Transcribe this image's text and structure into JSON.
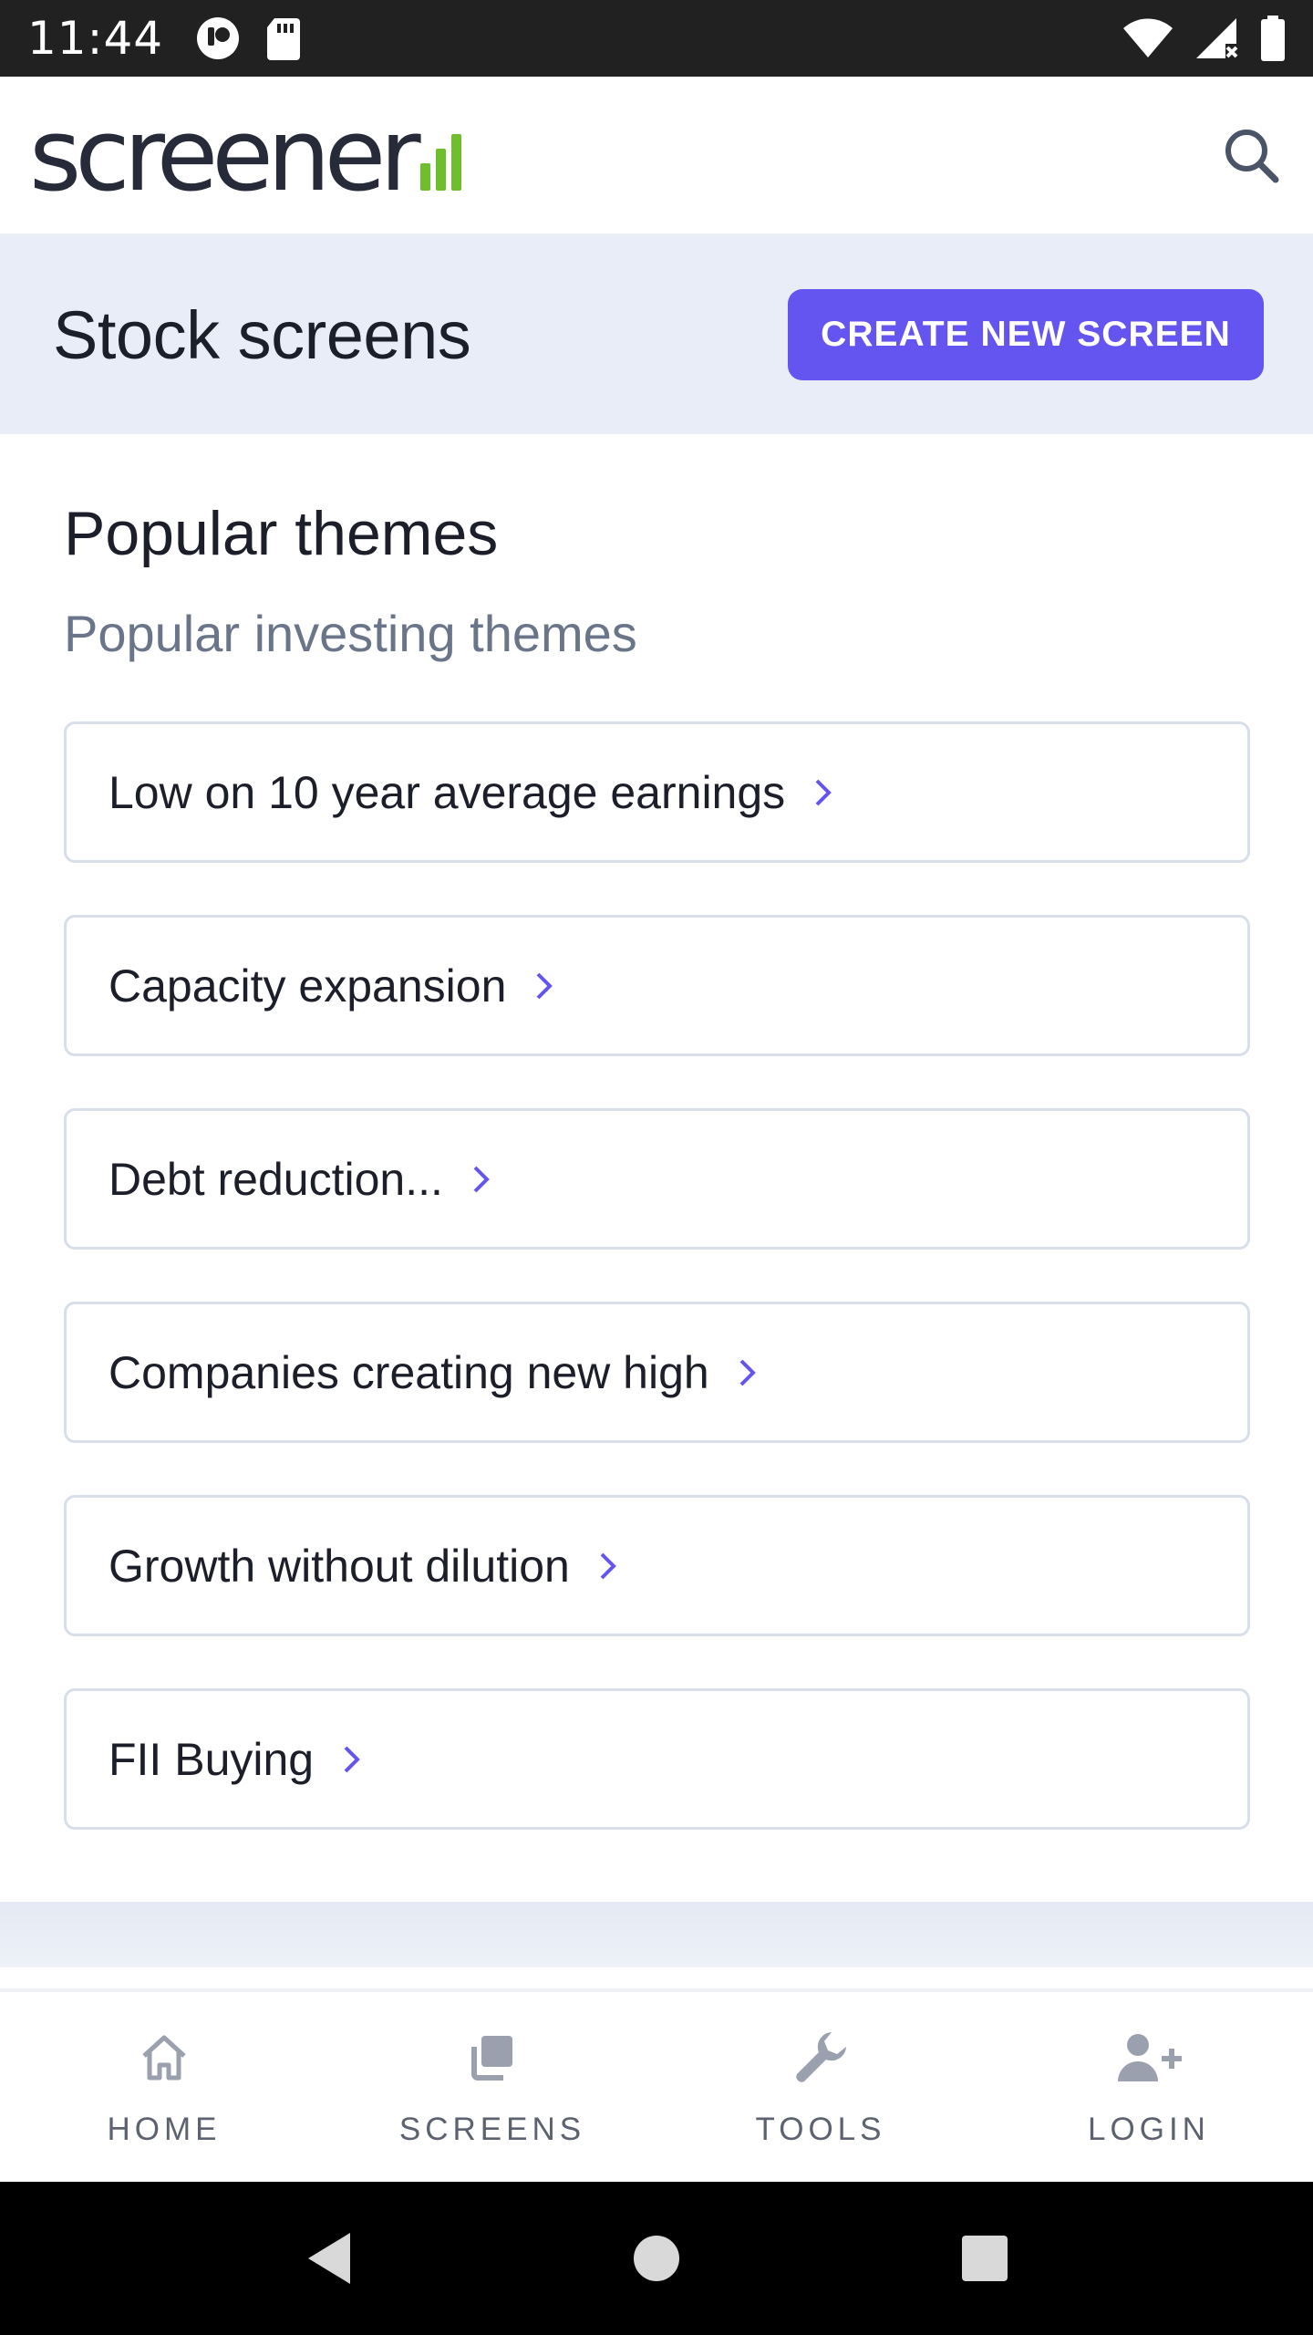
{
  "status_bar": {
    "time": "11:44",
    "icons": [
      "notification-app-icon",
      "sd-card-icon",
      "wifi-icon",
      "signal-icon",
      "battery-icon"
    ]
  },
  "header": {
    "logo_text": "screener",
    "logo_accent_color": "#6fbe2e",
    "search_icon": "search-icon"
  },
  "page": {
    "title": "Stock screens",
    "create_button_label": "CREATE NEW SCREEN",
    "accent_color": "#6454f0"
  },
  "popular": {
    "title": "Popular themes",
    "subtitle": "Popular investing themes",
    "items": [
      {
        "label": "Low on 10 year average earnings"
      },
      {
        "label": "Capacity expansion"
      },
      {
        "label": "Debt reduction..."
      },
      {
        "label": "Companies creating new high"
      },
      {
        "label": "Growth without dilution"
      },
      {
        "label": "FII Buying"
      }
    ]
  },
  "bottom_nav": {
    "items": [
      {
        "label": "HOME",
        "icon": "home-icon"
      },
      {
        "label": "SCREENS",
        "icon": "screens-icon"
      },
      {
        "label": "TOOLS",
        "icon": "wrench-icon"
      },
      {
        "label": "LOGIN",
        "icon": "add-user-icon"
      }
    ]
  },
  "system_nav": [
    "back-icon",
    "home-circle-icon",
    "recents-icon"
  ]
}
